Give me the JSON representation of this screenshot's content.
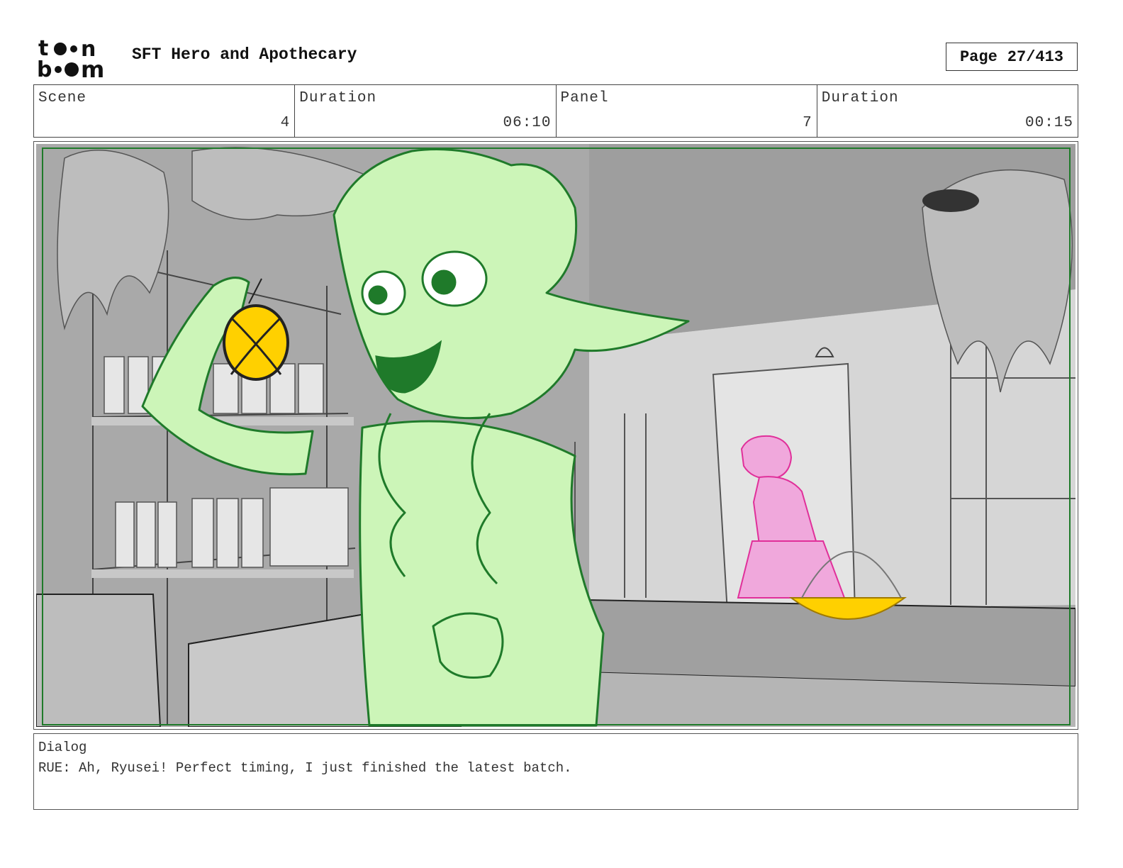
{
  "header": {
    "logo_text": "toon boom",
    "project_title": "SFT Hero and Apothecary",
    "page_label": "Page",
    "page_number": "27/413"
  },
  "info": {
    "scene_label": "Scene",
    "scene_value": "4",
    "scene_duration_label": "Duration",
    "scene_duration_value": "06:10",
    "panel_label": "Panel",
    "panel_value": "7",
    "panel_duration_label": "Duration",
    "panel_duration_value": "00:15"
  },
  "dialog": {
    "label": "Dialog",
    "text": "RUE: Ah, Ryusei! Perfect timing, I just finished the latest batch."
  },
  "colors": {
    "character_fill": "#ccf5b8",
    "character_line": "#1f7a2a",
    "potion": "#ffd000",
    "background_character": "#f0a8dc",
    "background_line": "#e0309a",
    "safe_area": "#1f7a2a"
  }
}
